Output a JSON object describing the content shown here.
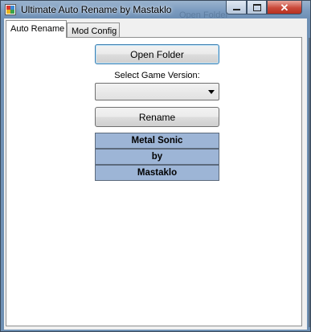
{
  "window": {
    "title": "Ultimate Auto Rename by Mastaklo",
    "background_title_text": "Open Folder"
  },
  "icons": {
    "app": "app-icon",
    "minimize": "minimize-icon",
    "maximize": "maximize-icon",
    "close": "close-icon",
    "dropdown": "chevron-down-icon"
  },
  "tabs": [
    {
      "label": "Auto Rename",
      "active": true
    },
    {
      "label": "Mod Config",
      "active": false
    }
  ],
  "auto_rename": {
    "open_folder_label": "Open Folder",
    "select_version_label": "Select Game Version:",
    "game_version_value": "",
    "rename_label": "Rename",
    "credits": [
      "Metal Sonic",
      "by",
      "Mastaklo"
    ]
  },
  "colors": {
    "credit_background": "#9db5d6",
    "titlebar": "#7b9bbf",
    "close_button": "#c9493a"
  }
}
